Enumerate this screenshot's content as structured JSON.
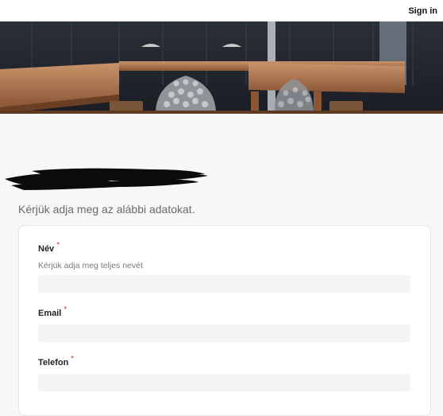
{
  "header": {
    "signin_label": "Sign in"
  },
  "hero": {
    "image": "sauna-banner"
  },
  "form": {
    "subtitle": "Kérjük adja meg az alábbi adatokat.",
    "required_mark": "*",
    "fields": [
      {
        "label": "Név",
        "hint": "Kérjük adja meg teljes nevét",
        "value": ""
      },
      {
        "label": "Email",
        "value": ""
      },
      {
        "label": "Telefon",
        "value": ""
      }
    ]
  },
  "colors": {
    "page_bg": "#f7f7f7",
    "required": "#e03131",
    "input_bg": "#f5f5f5",
    "subtitle": "#6a6a6a"
  }
}
